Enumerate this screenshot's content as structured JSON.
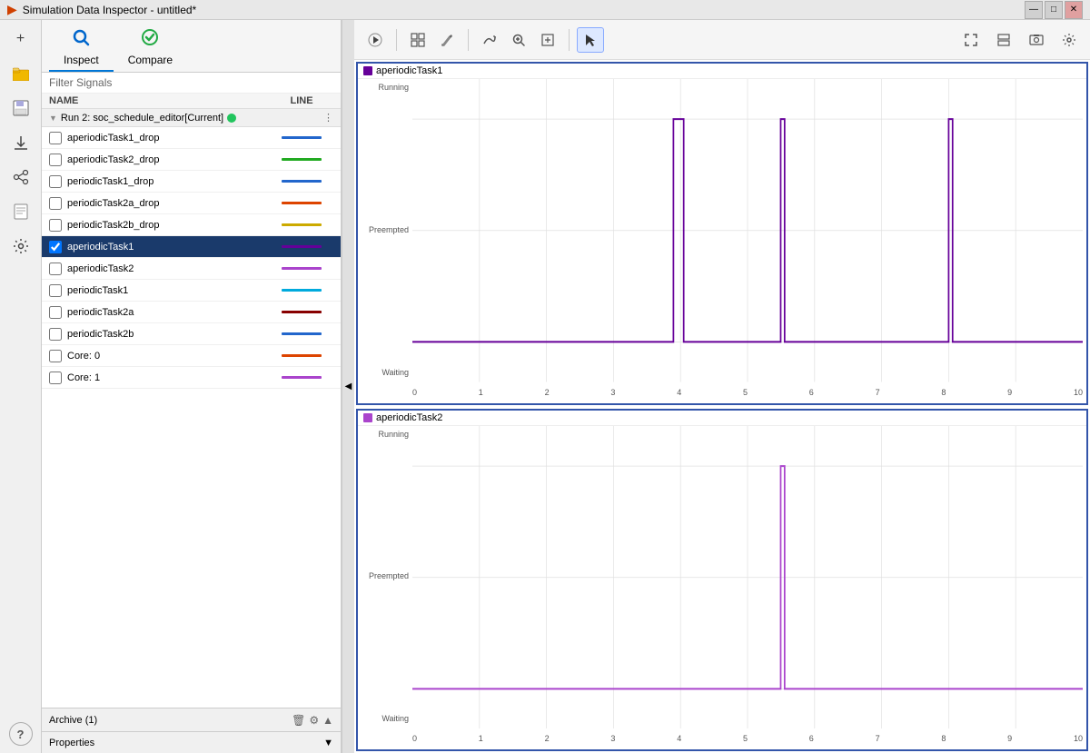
{
  "titleBar": {
    "title": "Simulation Data Inspector - untitled*",
    "icon": "▶"
  },
  "tabs": [
    {
      "id": "inspect",
      "label": "Inspect",
      "icon": "🔍",
      "active": true
    },
    {
      "id": "compare",
      "label": "Compare",
      "icon": "✅",
      "active": false
    }
  ],
  "filterSignals": "Filter Signals",
  "columns": {
    "name": "NAME",
    "line": "LINE"
  },
  "runHeader": "Run 2: soc_schedule_editor[Current]",
  "signals": [
    {
      "id": 1,
      "name": "aperiodicTask1_drop",
      "checked": false,
      "lineColor": "#2266cc",
      "lineDash": ""
    },
    {
      "id": 2,
      "name": "aperiodicTask2_drop",
      "checked": false,
      "lineColor": "#22aa22",
      "lineDash": ""
    },
    {
      "id": 3,
      "name": "periodicTask1_drop",
      "checked": false,
      "lineColor": "#2266cc",
      "lineDash": ""
    },
    {
      "id": 4,
      "name": "periodicTask2a_drop",
      "checked": false,
      "lineColor": "#dd4400",
      "lineDash": ""
    },
    {
      "id": 5,
      "name": "periodicTask2b_drop",
      "checked": false,
      "lineColor": "#ccaa00",
      "lineDash": ""
    },
    {
      "id": 6,
      "name": "aperiodicTask1",
      "checked": true,
      "lineColor": "#660099",
      "lineDash": "",
      "selected": true
    },
    {
      "id": 7,
      "name": "aperiodicTask2",
      "checked": false,
      "lineColor": "#aa44cc",
      "lineDash": ""
    },
    {
      "id": 8,
      "name": "periodicTask1",
      "checked": false,
      "lineColor": "#00aadd",
      "lineDash": ""
    },
    {
      "id": 9,
      "name": "periodicTask2a",
      "checked": false,
      "lineColor": "#880000",
      "lineDash": ""
    },
    {
      "id": 10,
      "name": "periodicTask2b",
      "checked": false,
      "lineColor": "#2266cc",
      "lineDash": ""
    },
    {
      "id": 11,
      "name": "Core: 0",
      "checked": false,
      "lineColor": "#dd4400",
      "lineDash": ""
    },
    {
      "id": 12,
      "name": "Core: 1",
      "checked": false,
      "lineColor": "#aa44cc",
      "lineDash": ""
    }
  ],
  "charts": [
    {
      "id": "chart1",
      "title": "aperiodicTask1",
      "titleColor": "#660099",
      "yLabels": [
        "Running",
        "Preempted",
        "Waiting"
      ],
      "xLabels": [
        "0",
        "1",
        "2",
        "3",
        "4",
        "5",
        "6",
        "7",
        "8",
        "9",
        "10"
      ],
      "signalColor": "#660099"
    },
    {
      "id": "chart2",
      "title": "aperiodicTask2",
      "titleColor": "#aa44cc",
      "yLabels": [
        "Running",
        "Preempted",
        "Waiting"
      ],
      "xLabels": [
        "0",
        "1",
        "2",
        "3",
        "4",
        "5",
        "6",
        "7",
        "8",
        "9",
        "10"
      ],
      "signalColor": "#aa44cc"
    }
  ],
  "archiveLabel": "Archive (1)",
  "propertiesLabel": "Properties",
  "toolbar": {
    "play": "▶",
    "grid": "⊞",
    "paint": "🖌",
    "zoom": "🔍",
    "fit": "⊡",
    "cursor": "↖",
    "fullscreen": "⤢",
    "layout": "⊟",
    "camera": "📷",
    "settings": "⚙"
  },
  "sidebarIcons": [
    {
      "id": "add",
      "icon": "+",
      "label": "add"
    },
    {
      "id": "folder",
      "icon": "📁",
      "label": "folder"
    },
    {
      "id": "save",
      "icon": "💾",
      "label": "save"
    },
    {
      "id": "download",
      "icon": "⬇",
      "label": "download"
    },
    {
      "id": "share",
      "icon": "↗",
      "label": "share"
    },
    {
      "id": "doc",
      "icon": "📄",
      "label": "document"
    },
    {
      "id": "settings",
      "icon": "⚙",
      "label": "settings"
    },
    {
      "id": "help",
      "icon": "?",
      "label": "help"
    }
  ]
}
